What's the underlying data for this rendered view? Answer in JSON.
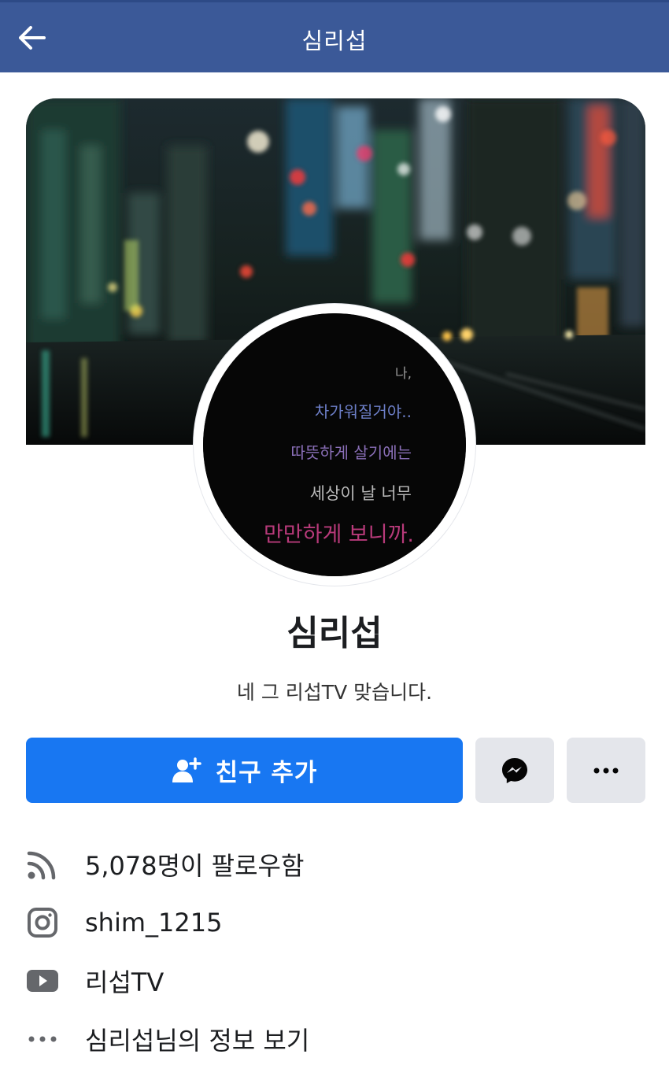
{
  "header": {
    "title": "심리섭",
    "back_icon": "arrow-left-icon",
    "bar_color": "#3b5998"
  },
  "profile": {
    "name": "심리섭",
    "bio": "네 그 리섭TV 맞습니다.",
    "avatar_lines": [
      "나,",
      "차가워질거야..",
      "따뜻하게 살기에는",
      "세상이 날 너무",
      "만만하게 보니까."
    ]
  },
  "actions": {
    "add_friend_label": "친구 추가",
    "add_friend_icon": "add-person-icon",
    "messenger_icon": "messenger-icon",
    "more_icon": "more-horizontal-icon",
    "primary_color": "#1877f2"
  },
  "info": {
    "followers": "5,078명이 팔로우함",
    "instagram": "shim_1215",
    "youtube": "리섭TV",
    "about": "심리섭님의 정보 보기"
  }
}
